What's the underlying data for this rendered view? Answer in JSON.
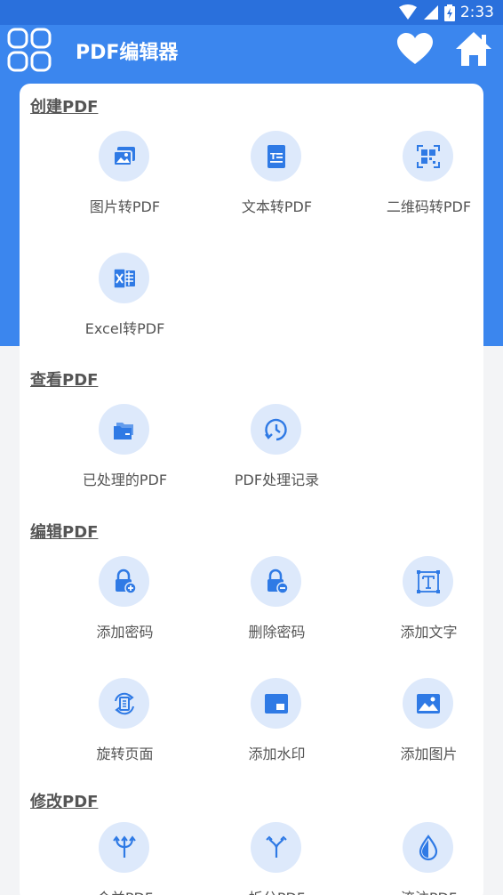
{
  "status": {
    "time": "2:33"
  },
  "appbar": {
    "title": "PDF编辑器"
  },
  "sections": [
    {
      "title": "创建PDF",
      "items": [
        {
          "label": "图片转PDF",
          "icon": "image-stack-icon"
        },
        {
          "label": "文本转PDF",
          "icon": "text-document-icon"
        },
        {
          "label": "二维码转PDF",
          "icon": "qr-code-icon"
        },
        {
          "label": "Excel转PDF",
          "icon": "excel-icon"
        }
      ]
    },
    {
      "title": "查看PDF",
      "items": [
        {
          "label": "已处理的PDF",
          "icon": "folder-icon"
        },
        {
          "label": "PDF处理记录",
          "icon": "history-icon"
        }
      ]
    },
    {
      "title": "编辑PDF",
      "items": [
        {
          "label": "添加密码",
          "icon": "lock-add-icon"
        },
        {
          "label": "删除密码",
          "icon": "lock-remove-icon"
        },
        {
          "label": "添加文字",
          "icon": "text-box-icon"
        },
        {
          "label": "旋转页面",
          "icon": "rotate-page-icon"
        },
        {
          "label": "添加水印",
          "icon": "watermark-icon"
        },
        {
          "label": "添加图片",
          "icon": "add-image-icon"
        }
      ]
    },
    {
      "title": "修改PDF",
      "items": [
        {
          "label": "合并PDF",
          "icon": "merge-icon"
        },
        {
          "label": "拆分PDF",
          "icon": "split-icon"
        },
        {
          "label": "流注PDF",
          "icon": "drop-icon"
        }
      ]
    }
  ],
  "colors": {
    "primary": "#3b86ee",
    "statusbar": "#2a70dc",
    "icon_bg": "#dde9fb",
    "icon_fg": "#2f7ae5"
  }
}
